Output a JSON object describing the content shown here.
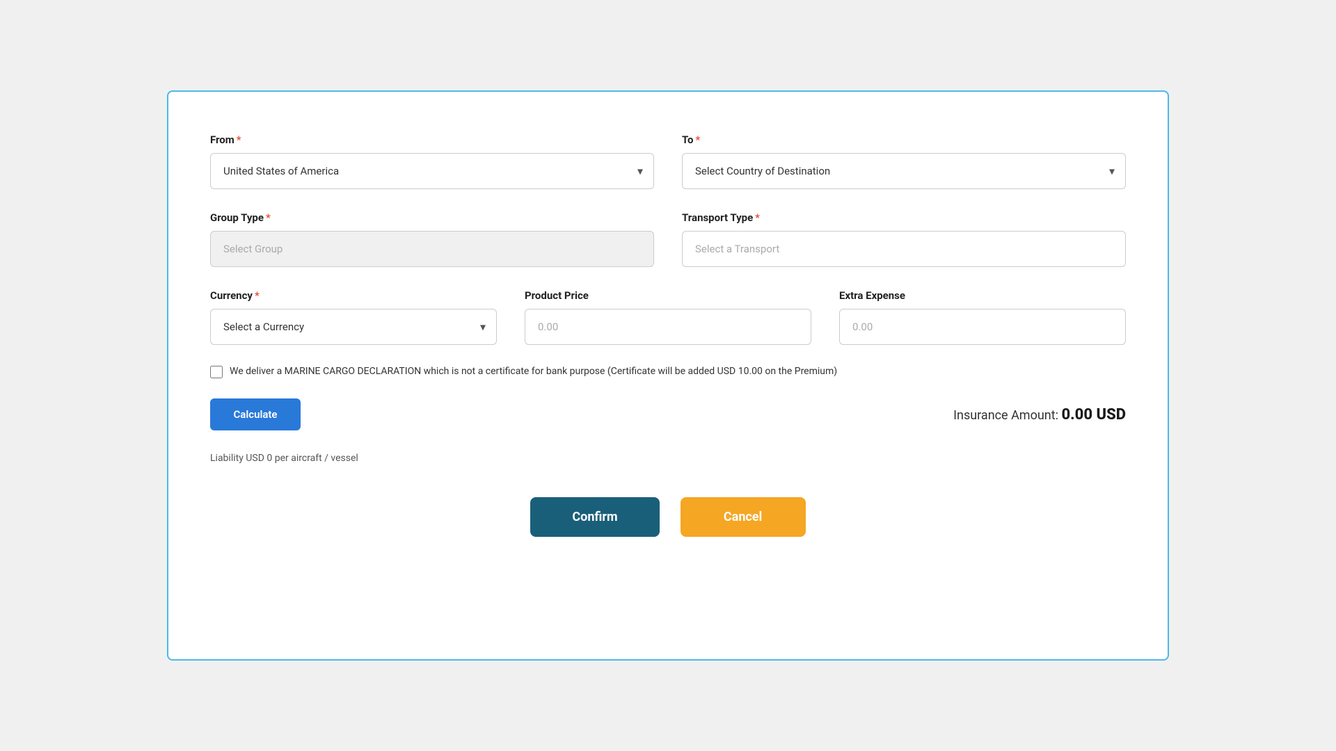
{
  "form": {
    "from_label": "From",
    "from_required": "*",
    "from_value": "United States of America",
    "from_placeholder": "United States of America",
    "to_label": "To",
    "to_required": "*",
    "to_placeholder": "Select Country of Destination",
    "group_type_label": "Group Type",
    "group_type_required": "*",
    "group_type_placeholder": "Select Group",
    "transport_type_label": "Transport Type",
    "transport_type_required": "*",
    "transport_type_placeholder": "Select a Transport",
    "currency_label": "Currency",
    "currency_required": "*",
    "currency_placeholder": "Select a Currency",
    "product_price_label": "Product Price",
    "product_price_placeholder": "0.00",
    "extra_expense_label": "Extra Expense",
    "extra_expense_placeholder": "0.00",
    "checkbox_label": "We deliver a MARINE CARGO DECLARATION which is not a certificate for bank purpose (Certificate will be added USD 10.00 on the Premium)",
    "calculate_btn_label": "Calculate",
    "insurance_amount_label": "Insurance Amount:",
    "insurance_amount_value": "0.00 USD",
    "liability_text": "Liability USD 0 per aircraft / vessel",
    "confirm_btn_label": "Confirm",
    "cancel_btn_label": "Cancel"
  },
  "icons": {
    "chevron_down": "▾"
  }
}
